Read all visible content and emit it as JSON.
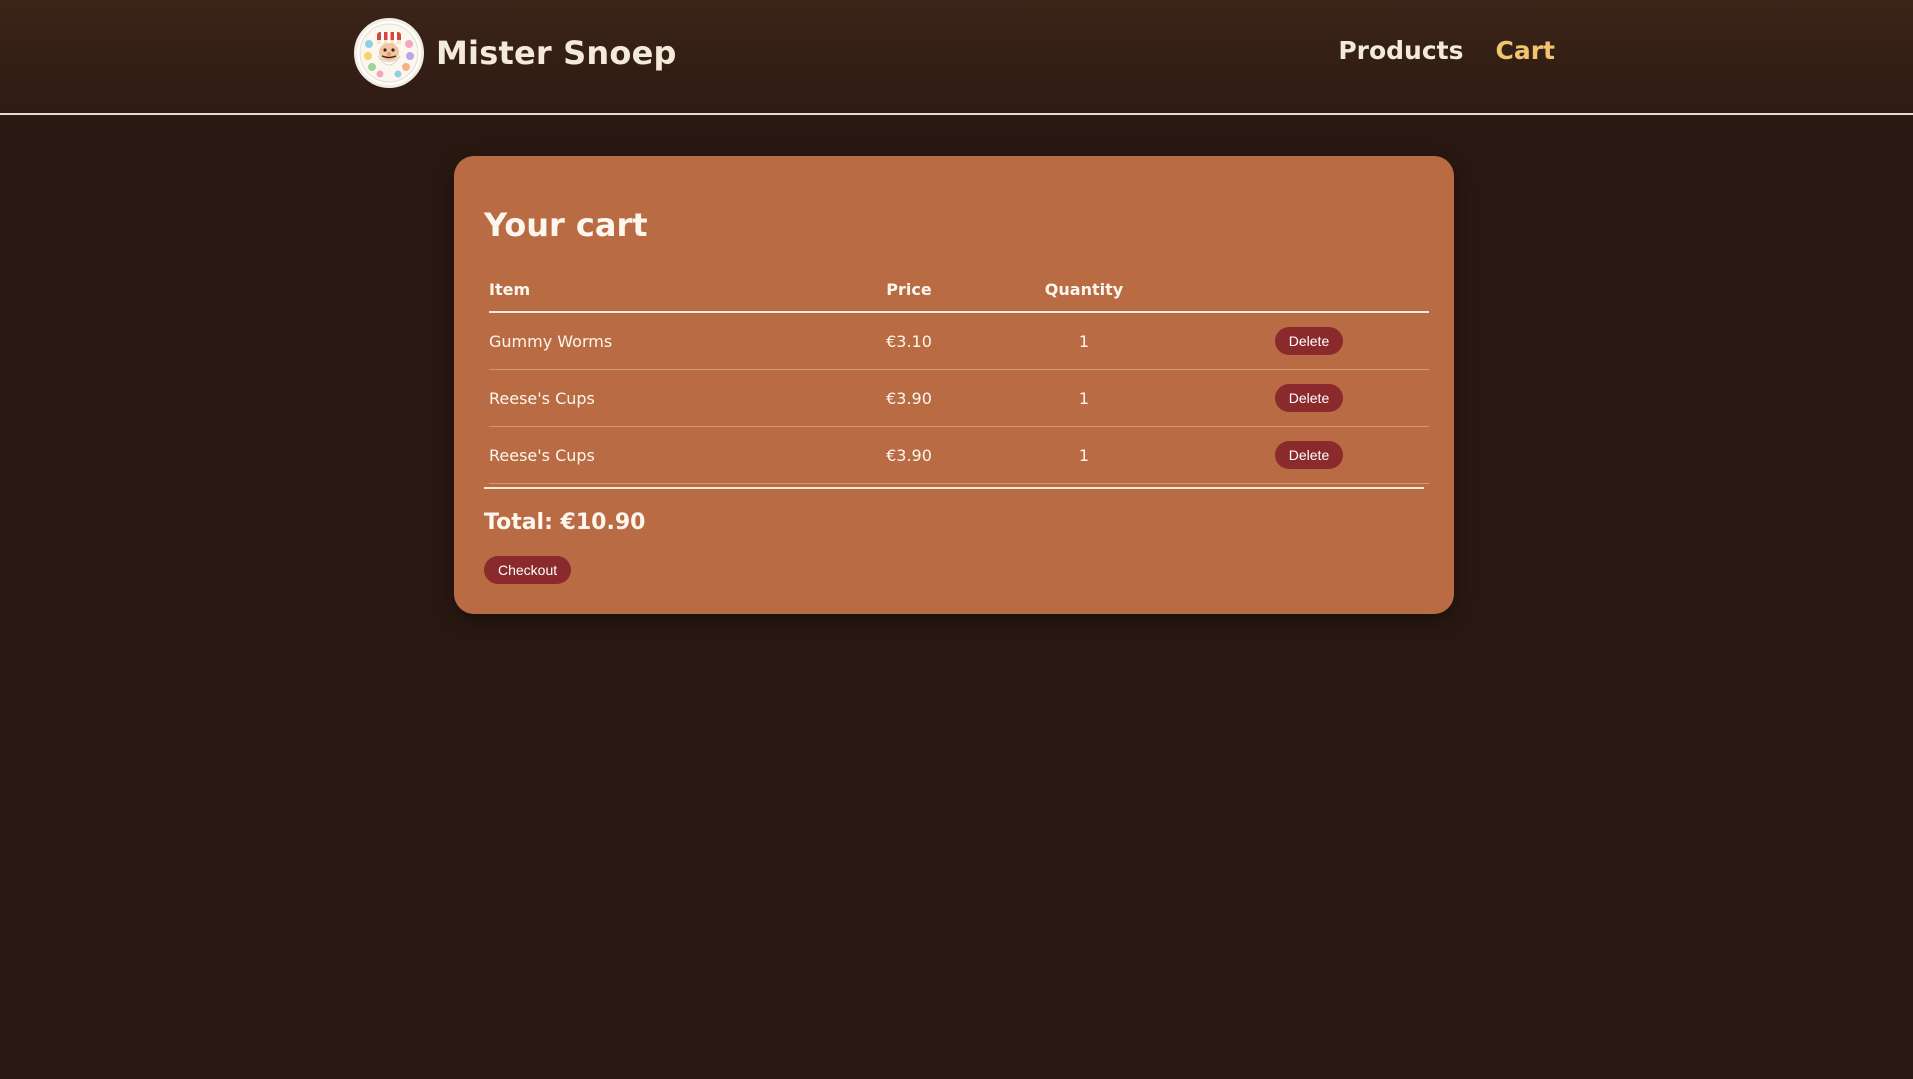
{
  "header": {
    "brand_name": "Mister Snoep",
    "nav": [
      {
        "label": "Products",
        "active": false
      },
      {
        "label": "Cart",
        "active": true
      }
    ]
  },
  "cart": {
    "title": "Your cart",
    "columns": {
      "item": "Item",
      "price": "Price",
      "quantity": "Quantity"
    },
    "rows": [
      {
        "item": "Gummy Worms",
        "price": "€3.10",
        "quantity": "1",
        "action": "Delete"
      },
      {
        "item": "Reese's Cups",
        "price": "€3.90",
        "quantity": "1",
        "action": "Delete"
      },
      {
        "item": "Reese's Cups",
        "price": "€3.90",
        "quantity": "1",
        "action": "Delete"
      }
    ],
    "total": "Total: €10.90",
    "checkout_label": "Checkout"
  },
  "colors": {
    "background": "#2a1912",
    "card": "#b96c43",
    "button": "#8b2a2c",
    "active_nav": "#f3c46f"
  }
}
